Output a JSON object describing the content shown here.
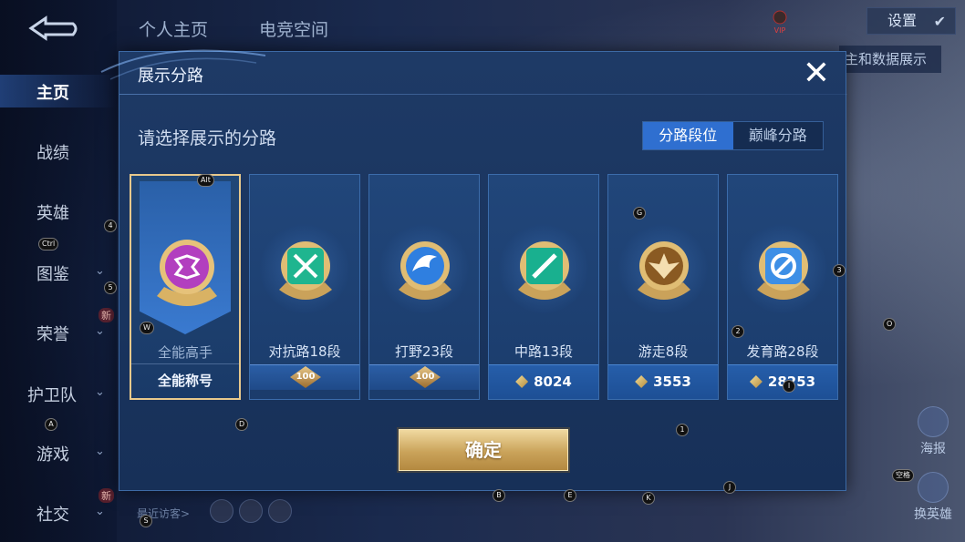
{
  "nav": {
    "items": [
      {
        "label": "主页",
        "active": true,
        "new": false,
        "chevron": false
      },
      {
        "label": "战绩",
        "active": false,
        "new": false,
        "chevron": false
      },
      {
        "label": "英雄",
        "active": false,
        "new": false,
        "chevron": false
      },
      {
        "label": "图鉴",
        "active": false,
        "new": false,
        "chevron": true
      },
      {
        "label": "荣誉",
        "active": false,
        "new": true,
        "chevron": true
      },
      {
        "label": "护卫队",
        "active": false,
        "new": false,
        "chevron": true
      },
      {
        "label": "游戏",
        "active": false,
        "new": false,
        "chevron": true
      },
      {
        "label": "社交",
        "active": false,
        "new": true,
        "chevron": true
      }
    ],
    "new_badge": "新"
  },
  "top": {
    "tabs": [
      "个人主页",
      "电竞空间"
    ],
    "vip_label": "VIP",
    "settings_label": "设置",
    "bg_partial_text": "主和数据展示"
  },
  "side_buttons": {
    "poster": "海报",
    "swap_hero": "换英雄"
  },
  "visitors_label": "最近访客>",
  "dialog": {
    "title": "展示分路",
    "prompt": "请选择展示的分路",
    "segments": [
      "分路段位",
      "巅峰分路"
    ],
    "active_segment": 0,
    "confirm_label": "确定",
    "cards": [
      {
        "name": "全能高手",
        "footer": "全能称号",
        "selected": true,
        "icon": "allround-emblem-icon",
        "color": "#b23fbf"
      },
      {
        "name": "对抗路18段",
        "footer_rank": "100",
        "selected": false,
        "icon": "clash-lane-emblem-icon",
        "color": "#1fb58f"
      },
      {
        "name": "打野23段",
        "footer_rank": "100",
        "selected": false,
        "icon": "jungle-emblem-icon",
        "color": "#2f7fe0"
      },
      {
        "name": "中路13段",
        "footer_score": "8024",
        "selected": false,
        "icon": "mid-lane-emblem-icon",
        "color": "#19b08f"
      },
      {
        "name": "游走8段",
        "footer_score": "3553",
        "selected": false,
        "icon": "roam-emblem-icon",
        "color": "#c99a4a"
      },
      {
        "name": "发育路28段",
        "footer_score": "28253",
        "selected": false,
        "icon": "farm-lane-emblem-icon",
        "color": "#3d8fe6"
      }
    ]
  },
  "key_hints": [
    "Alt",
    "4",
    "Ctrl",
    "5",
    "W",
    "G",
    "3",
    "2",
    "O",
    "A",
    "D",
    "1",
    "空格",
    "B",
    "E",
    "K",
    "J",
    "S",
    "I"
  ]
}
